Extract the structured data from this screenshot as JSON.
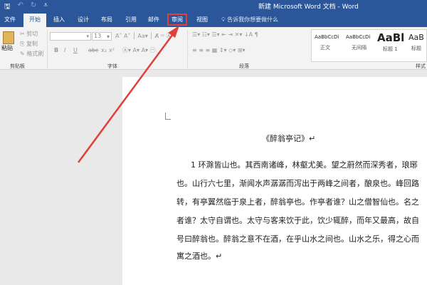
{
  "window": {
    "title": "新建 Microsoft Word 文档 - Word",
    "qat": [
      "save-icon",
      "undo-icon",
      "redo-icon",
      "customize-icon"
    ]
  },
  "tabs": [
    "文件",
    "开始",
    "插入",
    "设计",
    "布局",
    "引用",
    "邮件",
    "审阅",
    "视图"
  ],
  "active_tab": "开始",
  "highlighted_tab": "审阅",
  "tell_me": "告诉我你想要做什么",
  "ribbon": {
    "clipboard": {
      "paste": "粘贴",
      "cut": "剪切",
      "copy": "复制",
      "format_painter": "格式刷",
      "label": "剪贴板"
    },
    "font": {
      "font_name": "",
      "font_size": "13",
      "label": "字体",
      "buttons": [
        "B",
        "I",
        "U",
        "abc",
        "x₂",
        "x²"
      ]
    },
    "paragraph": {
      "label": "段落"
    },
    "styles": {
      "label": "样式",
      "items": [
        {
          "preview": "AaBbCcDi",
          "name": "正文"
        },
        {
          "preview": "AaBbCcDi",
          "name": "无间隔"
        },
        {
          "preview": "AaBl",
          "name": "标题 1"
        },
        {
          "preview": "AaB",
          "name": "标题"
        }
      ]
    }
  },
  "document": {
    "title": "《醉翁亭记》↵",
    "lines": [
      "1 环滁皆山也。其西南诸峰，林壑尤美。望之蔚然而深秀者，琅琊",
      "也。山行六七里，渐闻水声潺潺而泻出于两峰之间者，酿泉也。峰回路",
      "转，有亭翼然临于泉上者，醉翁亭也。作亭者谁？山之僧智仙也。名之",
      "者谁？太守自谓也。太守与客来饮于此，饮少辄醉，而年又最高，故自",
      "号曰醉翁也。醉翁之意不在酒，在乎山水之间也。山水之乐，得之心而",
      "寓之酒也。↵"
    ]
  },
  "colors": {
    "brand": "#2b579a",
    "annotation": "#e0403a"
  }
}
